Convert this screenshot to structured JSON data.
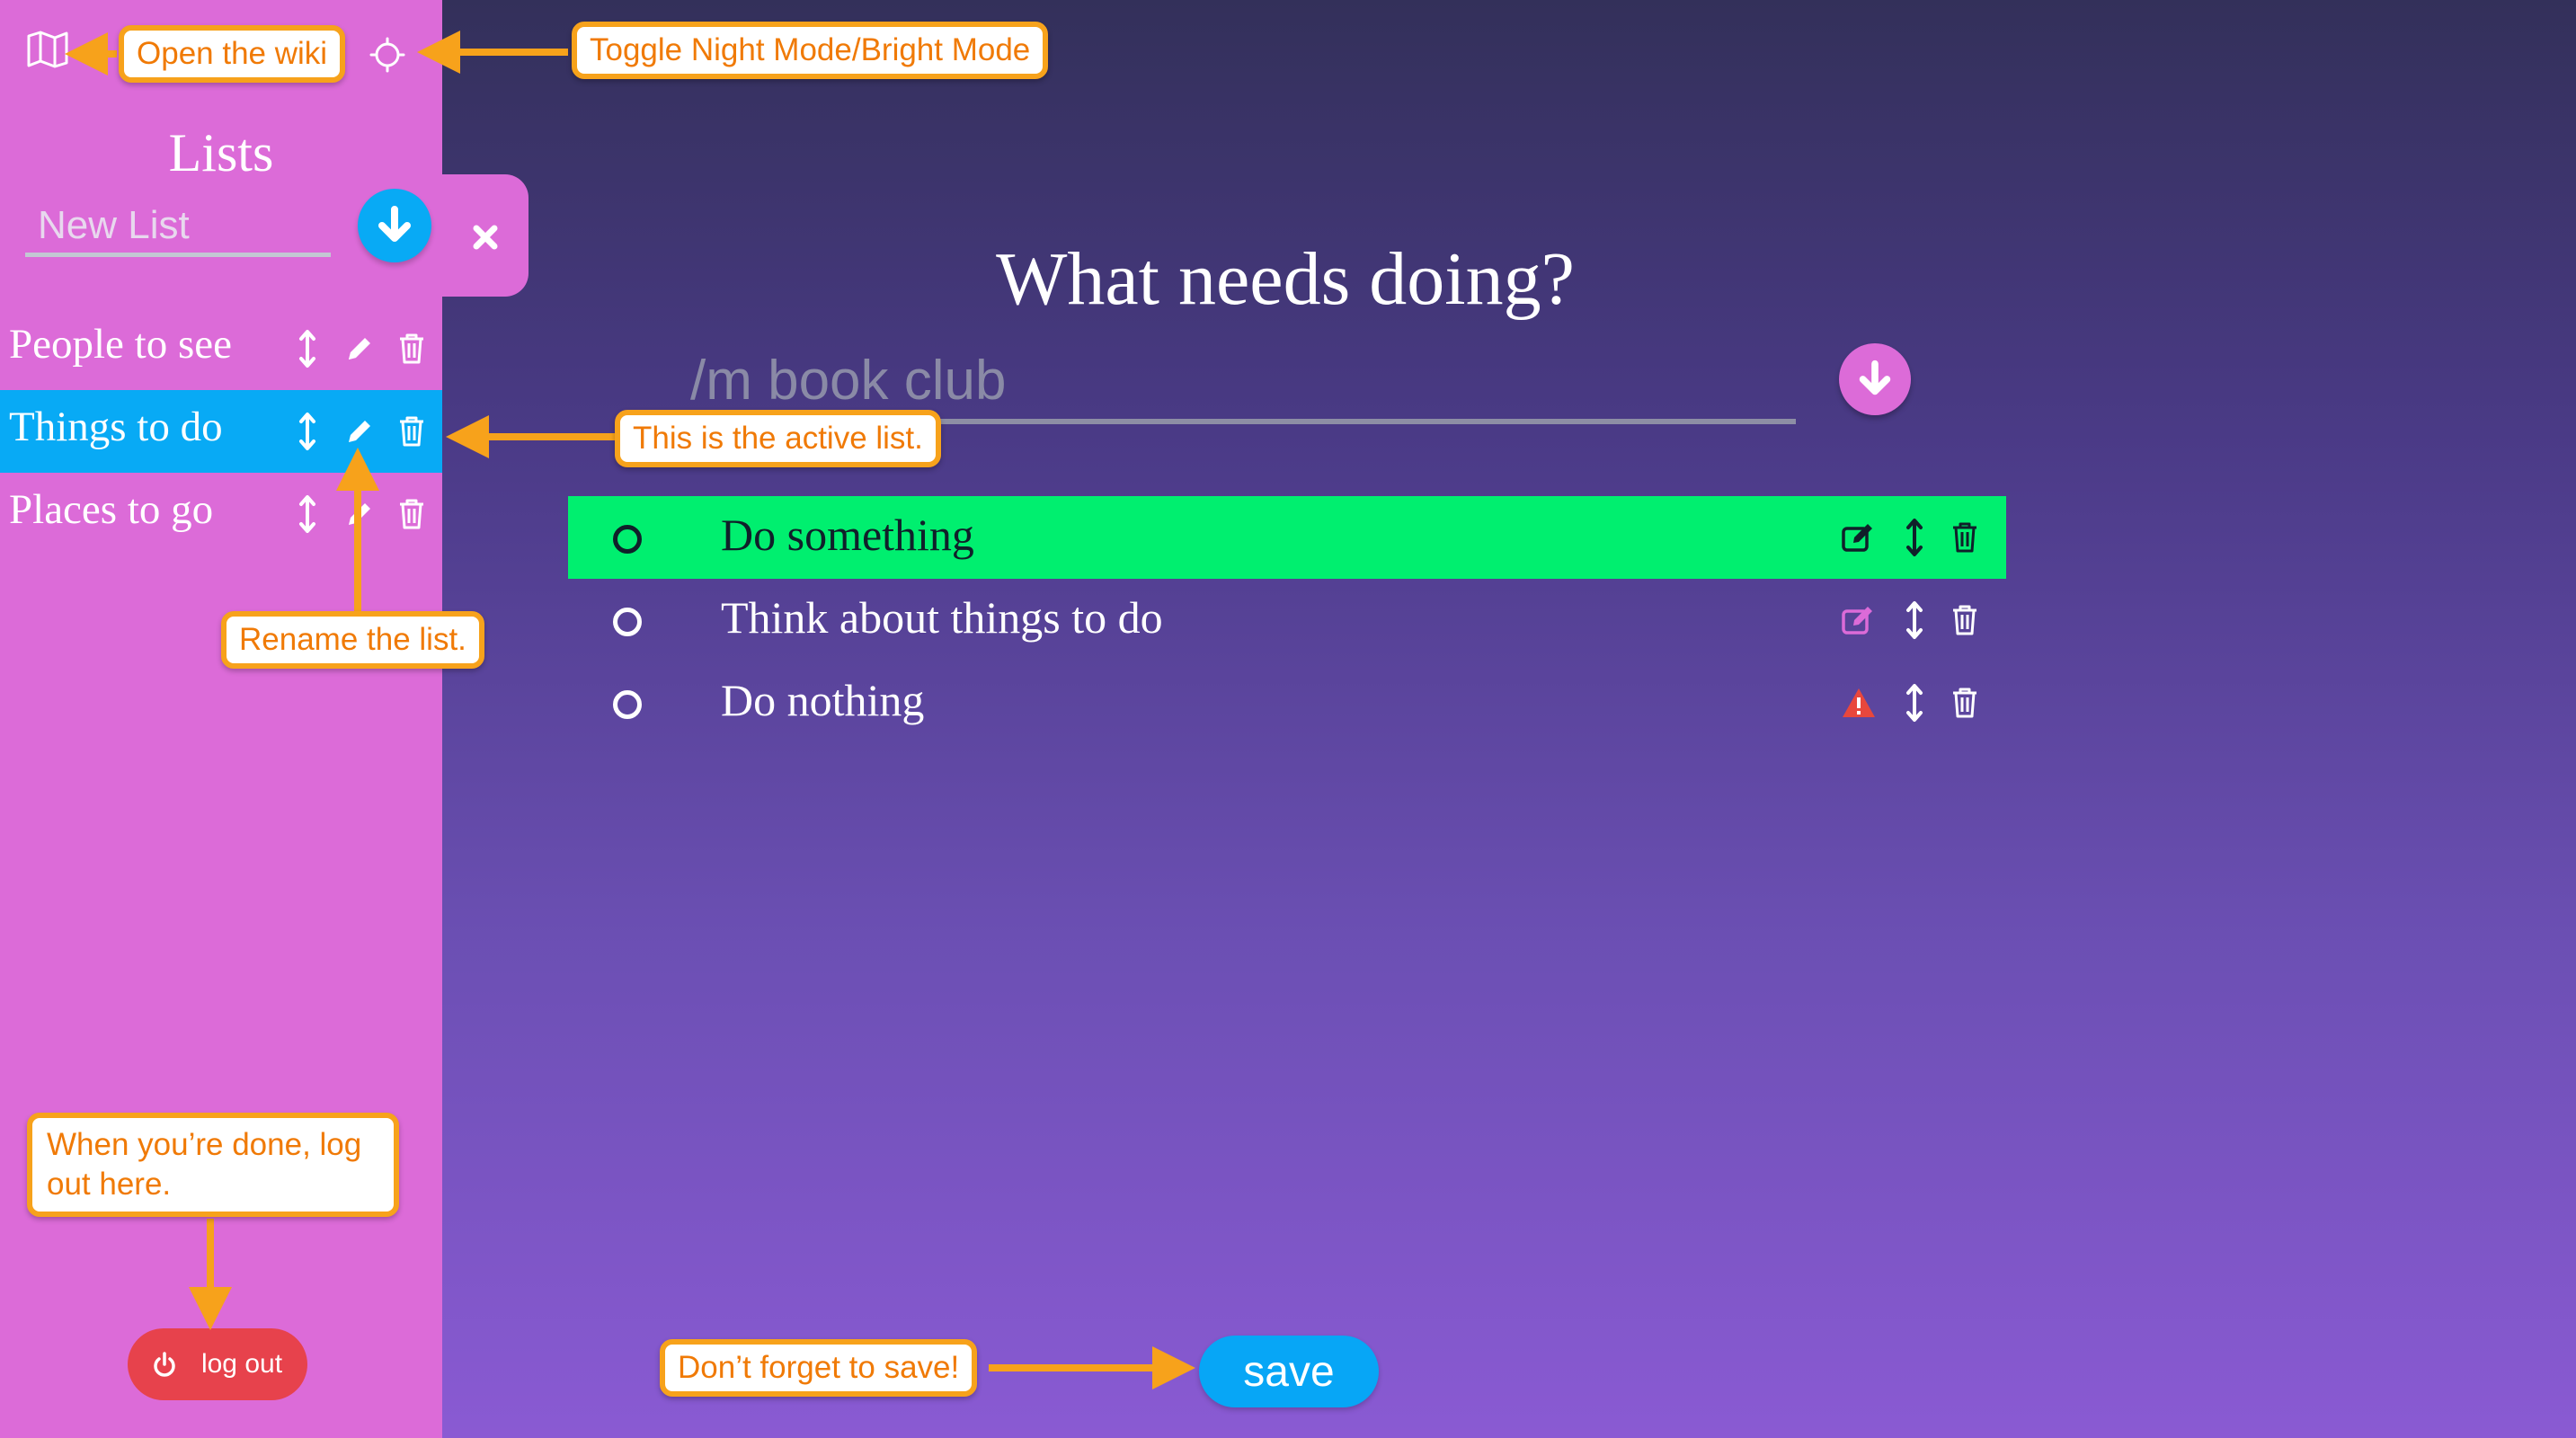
{
  "colors": {
    "sidebar": "#dc6bd8",
    "active_list": "#08aaf5",
    "highlight_task": "#00ef6f",
    "callout_border": "#f7a21b",
    "callout_text": "#f07a06",
    "logout": "#e7424c",
    "save": "#07a6f6",
    "warning": "#e8473c"
  },
  "header": {
    "wiki_icon": "map-icon",
    "theme_icon": "sun-icon"
  },
  "sidebar": {
    "title": "Lists",
    "new_list_placeholder": "New List",
    "add_icon": "arrow-down-circle-icon",
    "close_icon": "close-icon",
    "lists": [
      {
        "label": "People to see",
        "active": false
      },
      {
        "label": "Things to do",
        "active": true
      },
      {
        "label": "Places to go",
        "active": false
      }
    ],
    "logout_label": "log out",
    "logout_icon": "power-icon"
  },
  "main": {
    "title": "What needs doing?",
    "input_placeholder": "/m book club",
    "tasks": [
      {
        "text": "Do something",
        "status": "highlighted",
        "action_icon": "edit-icon"
      },
      {
        "text": "Think about things to do",
        "status": "normal",
        "action_icon": "edit-icon"
      },
      {
        "text": "Do nothing",
        "status": "warning",
        "action_icon": "warning-icon"
      }
    ],
    "save_label": "save"
  },
  "callouts": {
    "wiki": "Open the wiki",
    "theme": "Toggle Night Mode/Bright Mode",
    "active_list": "This is the active list.",
    "rename": "Rename the list.",
    "logout": "When you’re done, log out here.",
    "save": "Don’t forget to save!"
  }
}
